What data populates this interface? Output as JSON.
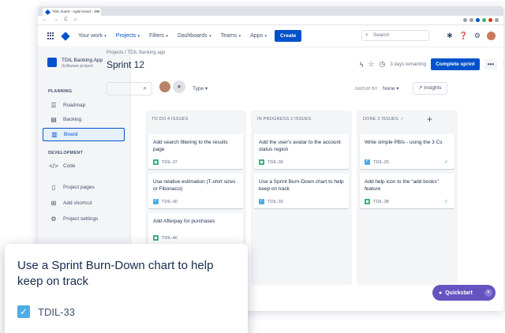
{
  "browser": {
    "tab_title": "TDIL board - Agile board - Jira",
    "tab_close": "×",
    "nav_controls": "← → C ⌂"
  },
  "topnav": {
    "your_work": "Your work",
    "projects": "Projects",
    "filters": "Filters",
    "dashboards": "Dashboards",
    "teams": "Teams",
    "apps": "Apps",
    "create": "Create",
    "search_placeholder": "Search"
  },
  "sidebar": {
    "project_name": "TDIL Banking App",
    "project_type": "Software project",
    "planning_heading": "PLANNING",
    "development_heading": "DEVELOPMENT",
    "items": [
      {
        "label": "Roadmap"
      },
      {
        "label": "Backlog"
      },
      {
        "label": "Board"
      },
      {
        "label": "Code"
      },
      {
        "label": "Project pages"
      },
      {
        "label": "Add shortcut"
      },
      {
        "label": "Project settings"
      }
    ]
  },
  "header": {
    "breadcrumb": "Projects / TDIL Banking app",
    "title": "Sprint 12",
    "days_remaining": "3 days remaining",
    "complete_sprint": "Complete sprint",
    "more": "•••"
  },
  "toolbar": {
    "type_label": "Type",
    "group_by_label": "GROUP BY",
    "group_by_value": "None",
    "insights": "Insights"
  },
  "columns": [
    {
      "heading": "TO DO 4 ISSUES",
      "cards": [
        {
          "title": "Add search filtering to the results page",
          "key": "TDIL-37",
          "type": "story"
        },
        {
          "title": "Use relative estimation (T-shirt sizes or Fibonacci)",
          "key": "TDIL-30",
          "type": "task"
        },
        {
          "title": "Add Afterpay for purchases",
          "key": "TDIL-46",
          "type": "story"
        }
      ]
    },
    {
      "heading": "IN PROGRESS 2 ISSUES",
      "cards": [
        {
          "title": "Add the user's avatar to the account status region",
          "key": "TDIL-36",
          "type": "story"
        },
        {
          "title": "Use a Sprint Burn-Down chart to help keep on track",
          "key": "TDIL-33",
          "type": "task"
        }
      ]
    },
    {
      "heading": "DONE 2 ISSUES",
      "cards": [
        {
          "title": "Write simple PBIs - using the 3 Cs",
          "key": "TDIL-25",
          "type": "task"
        },
        {
          "title": "Add help icon to the \"add books\" feature",
          "key": "TDIL-38",
          "type": "story"
        }
      ]
    }
  ],
  "quickstart": {
    "label": "Quickstart",
    "close": "×"
  },
  "zoom_card": {
    "title": "Use a Sprint Burn-Down chart to help keep on track",
    "key": "TDIL-33"
  },
  "colors": {
    "brand_blue": "#0052cc",
    "story_green": "#36b37e",
    "task_blue": "#4bade8",
    "quickstart_purple": "#6554c0"
  }
}
